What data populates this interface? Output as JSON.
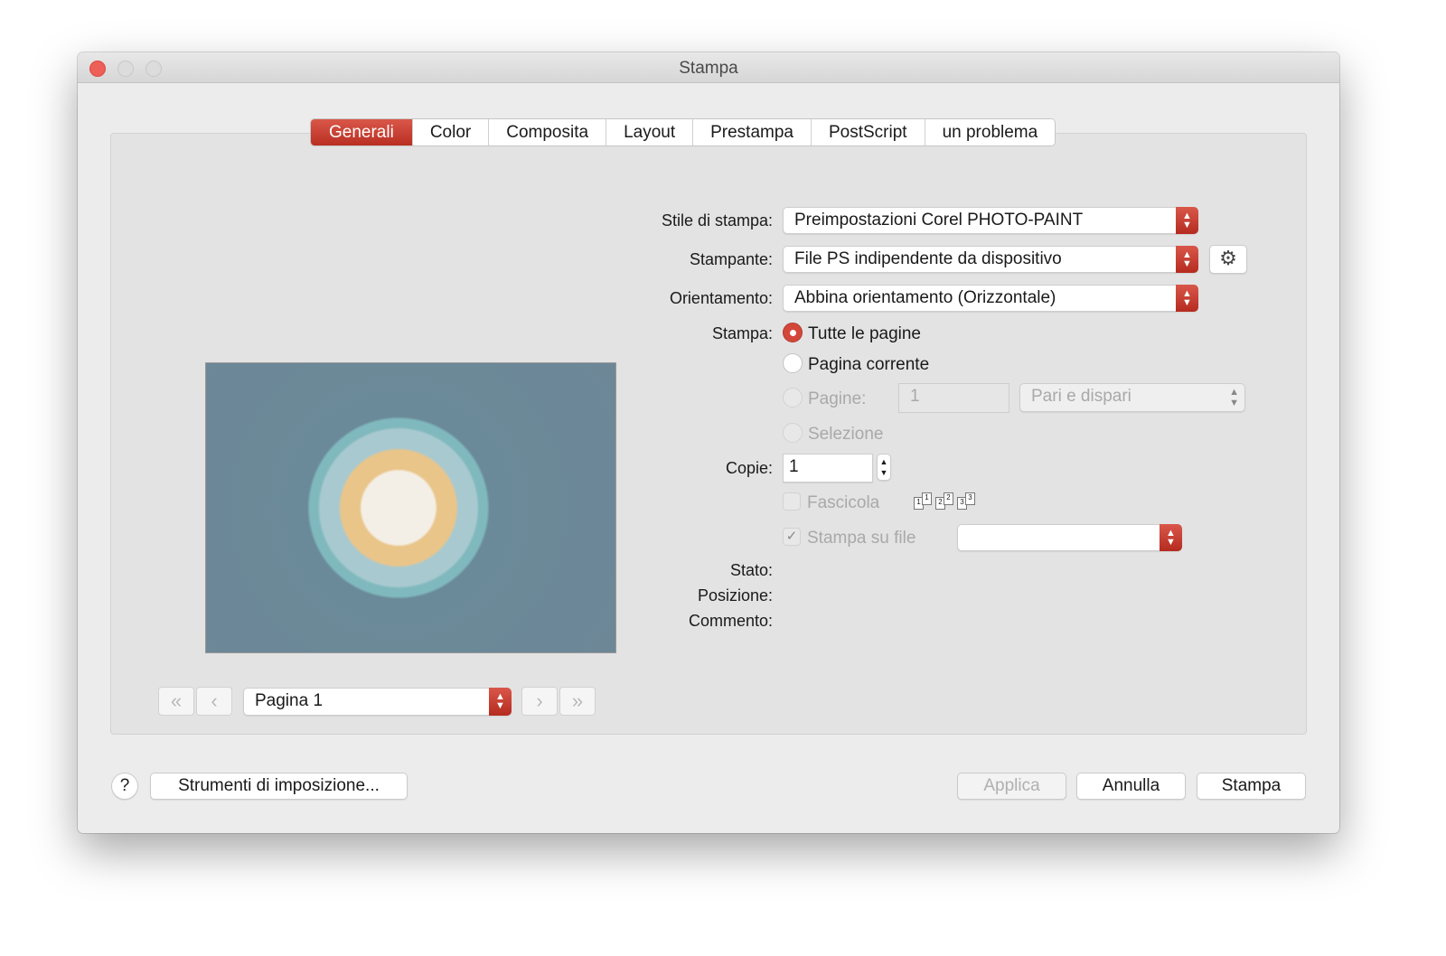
{
  "window": {
    "title": "Stampa"
  },
  "tabs": [
    "Generali",
    "Color",
    "Composita",
    "Layout",
    "Prestampa",
    "PostScript",
    "un problema"
  ],
  "form": {
    "style_label": "Stile di stampa:",
    "style_value": "Preimpostazioni Corel PHOTO-PAINT",
    "printer_label": "Stampante:",
    "printer_value": "File PS indipendente da dispositivo",
    "orient_label": "Orientamento:",
    "orient_value": "Abbina orientamento (Orizzontale)",
    "print_label": "Stampa:",
    "opt_all": "Tutte le pagine",
    "opt_current": "Pagina corrente",
    "opt_pages": "Pagine:",
    "pages_value": "1",
    "parity_value": "Pari e dispari",
    "opt_selection": "Selezione",
    "copies_label": "Copie:",
    "copies_value": "1",
    "collate_label": "Fascicola",
    "collate_icon_nums": [
      "1",
      "1",
      "2",
      "2",
      "3",
      "3"
    ],
    "print_to_file_label": "Stampa su file",
    "print_to_file_checked": true,
    "status_label": "Stato:",
    "location_label": "Posizione:",
    "comment_label": "Commento:"
  },
  "preview": {
    "page_select": "Pagina 1"
  },
  "footer": {
    "help": "?",
    "imposition": "Strumenti di imposizione...",
    "apply": "Applica",
    "cancel": "Annulla",
    "print": "Stampa"
  },
  "colors": {
    "accent": "#c93b2e",
    "close": "#ee5f57"
  }
}
